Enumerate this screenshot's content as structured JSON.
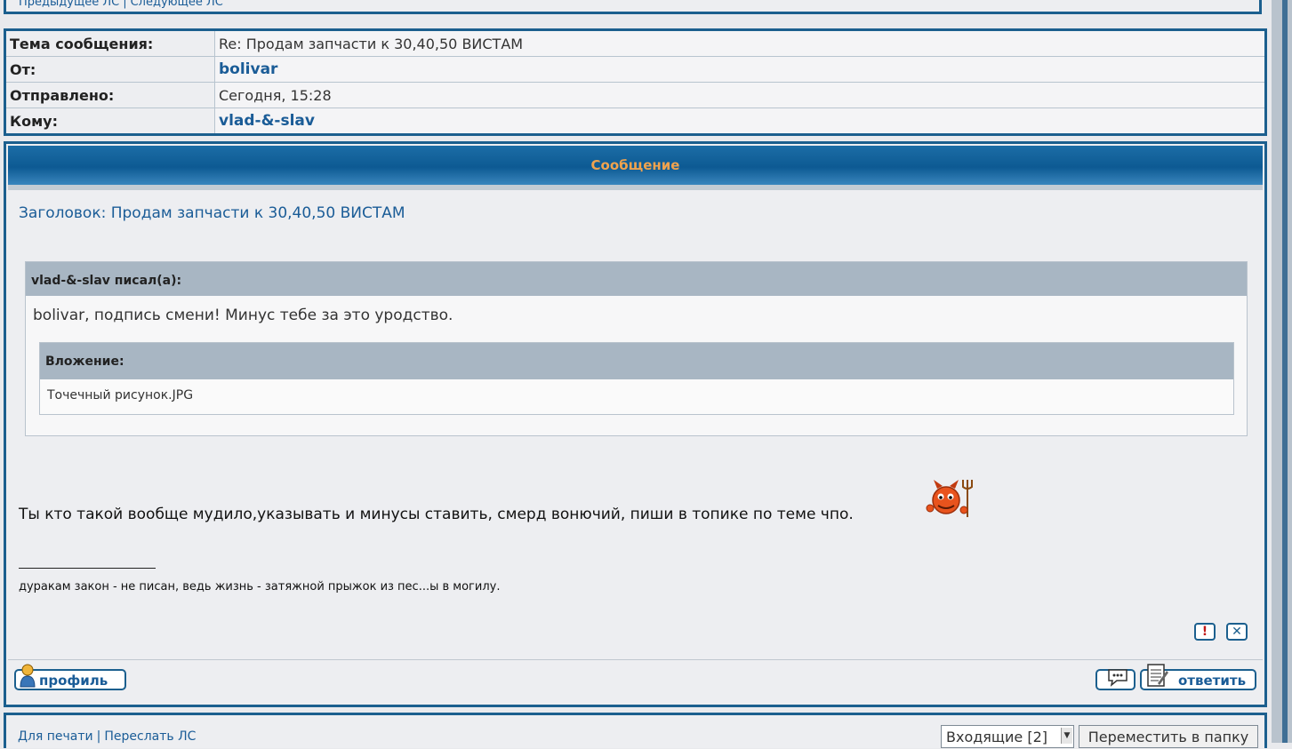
{
  "nav_top": {
    "prev": "Предыдущее ЛС",
    "separator": "|",
    "next": "Следующее ЛС"
  },
  "header": {
    "rows": [
      {
        "label": "Тема сообщения:",
        "value": "Re: Продам запчасти к 30,40,50 ВИСТАМ"
      },
      {
        "label": "От:",
        "value": "bolivar"
      },
      {
        "label": "Отправлено:",
        "value": "Сегодня, 15:28"
      },
      {
        "label": "Кому:",
        "value": "vlad-&-slav"
      }
    ]
  },
  "message": {
    "panel_title": "Сообщение",
    "subject": "Заголовок: Продам запчасти к 30,40,50 ВИСТАМ",
    "quote": {
      "header": "vlad-&-slav писал(а):",
      "text": "bolivar, подпись смени! Минус тебе за это уродство.",
      "attachment_header": "Вложение:",
      "attachment_file": "Точечный рисунок.JPG"
    },
    "body": "Ты кто такой вообще мудило,указывать и минусы ставить, смерд вонючий, пиши в топике по теме чпо.",
    "signature": "дуракам закон - не писан, ведь жизнь - затяжной прыжок из пес...ы в могилу.",
    "report_glyph": "!",
    "delete_glyph": "✕",
    "profile_label": "профиль",
    "reply_label": "ответить",
    "icons": {
      "report": "exclamation-icon",
      "delete": "close-icon",
      "profile": "user-icon",
      "quote": "speech-bubble-icon",
      "reply": "notepad-icon",
      "smiley": "devil-smiley-icon"
    }
  },
  "nav_bottom": {
    "print": "Для печати",
    "separator": "|",
    "forward": "Переслать ЛС",
    "folder_select": "Входящие [2]",
    "move_button": "Переместить в папку"
  },
  "colors": {
    "border": "#1b5f8e",
    "link": "#1a5c97",
    "panel_title": "#f0a34e"
  }
}
